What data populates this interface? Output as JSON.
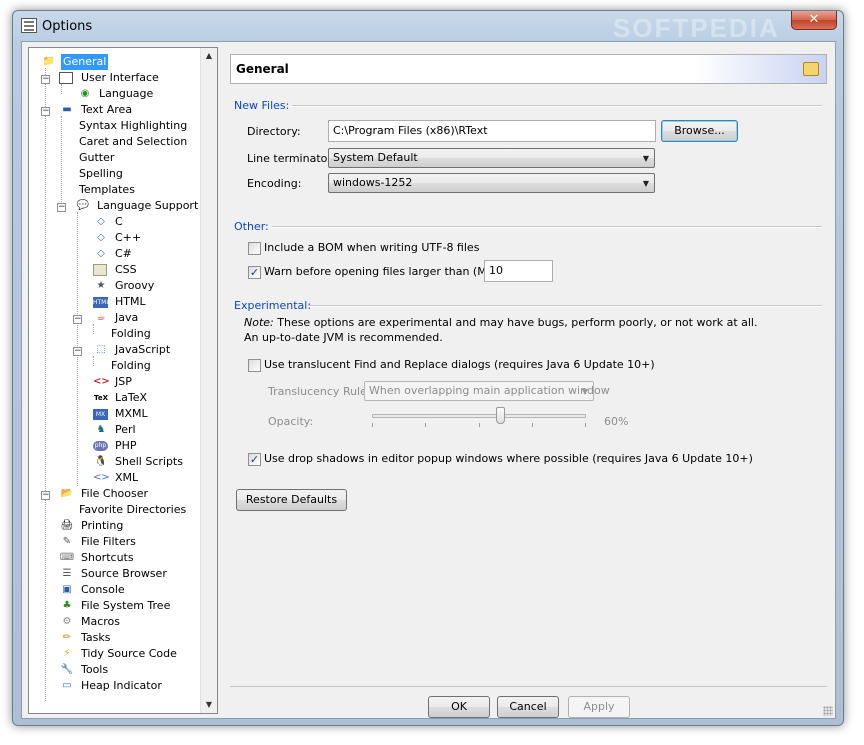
{
  "window": {
    "title": "Options",
    "watermark": "SOFTPEDIA",
    "close_label": "✕"
  },
  "tree": {
    "items": [
      {
        "label": "General",
        "icon": "folder-icon",
        "selected": true
      },
      {
        "label": "User Interface",
        "icon": "window-icon"
      },
      {
        "label": "Language",
        "icon": "globe-icon"
      },
      {
        "label": "Text Area",
        "icon": "text-area-icon"
      },
      {
        "label": "Syntax Highlighting"
      },
      {
        "label": "Caret and Selection"
      },
      {
        "label": "Gutter"
      },
      {
        "label": "Spelling"
      },
      {
        "label": "Templates"
      },
      {
        "label": "Language Support",
        "icon": "speech-bubble-icon"
      },
      {
        "label": "C",
        "icon": "c-file-icon"
      },
      {
        "label": "C++",
        "icon": "cpp-file-icon"
      },
      {
        "label": "C#",
        "icon": "csharp-file-icon"
      },
      {
        "label": "CSS",
        "icon": "css-file-icon"
      },
      {
        "label": "Groovy",
        "icon": "groovy-icon"
      },
      {
        "label": "HTML",
        "icon": "html-icon"
      },
      {
        "label": "Java",
        "icon": "java-cup-icon"
      },
      {
        "label": "Folding"
      },
      {
        "label": "JavaScript",
        "icon": "javascript-icon"
      },
      {
        "label": "Folding"
      },
      {
        "label": "JSP",
        "icon": "jsp-icon"
      },
      {
        "label": "LaTeX",
        "icon": "latex-icon"
      },
      {
        "label": "MXML",
        "icon": "mxml-icon"
      },
      {
        "label": "Perl",
        "icon": "camel-icon"
      },
      {
        "label": "PHP",
        "icon": "php-icon"
      },
      {
        "label": "Shell Scripts",
        "icon": "penguin-icon"
      },
      {
        "label": "XML",
        "icon": "xml-icon"
      },
      {
        "label": "File Chooser",
        "icon": "open-folder-icon"
      },
      {
        "label": "Favorite Directories"
      },
      {
        "label": "Printing",
        "icon": "printer-icon"
      },
      {
        "label": "File Filters",
        "icon": "filter-icon"
      },
      {
        "label": "Shortcuts",
        "icon": "keyboard-icon"
      },
      {
        "label": "Source Browser",
        "icon": "list-icon"
      },
      {
        "label": "Console",
        "icon": "monitor-icon"
      },
      {
        "label": "File System Tree",
        "icon": "tree-icon"
      },
      {
        "label": "Macros",
        "icon": "gear-icon"
      },
      {
        "label": "Tasks",
        "icon": "pencil-icon"
      },
      {
        "label": "Tidy Source Code",
        "icon": "lightning-icon"
      },
      {
        "label": "Tools",
        "icon": "wrench-icon"
      },
      {
        "label": "Heap Indicator",
        "icon": "heap-icon"
      }
    ],
    "expanders": [
      "−",
      "−",
      "−",
      "−",
      "−",
      "−",
      "−"
    ]
  },
  "panel": {
    "title": "General",
    "new_files": {
      "section_label": "New Files:",
      "directory_label": "Directory:",
      "directory_value": "C:\\Program Files (x86)\\RText",
      "browse_label": "Browse...",
      "line_terminator_label": "Line terminator:",
      "line_terminator_value": "System Default",
      "encoding_label": "Encoding:",
      "encoding_value": "windows-1252"
    },
    "other": {
      "section_label": "Other:",
      "bom_label": "Include a BOM when writing UTF-8 files",
      "bom_checked": false,
      "warn_label": "Warn before opening files larger than (MB):",
      "warn_checked": true,
      "warn_value": "10"
    },
    "experimental": {
      "section_label": "Experimental:",
      "note_prefix": "Note:",
      "note_text": " These options are experimental and may have bugs, perform poorly, or not work at all.",
      "note_text_2": "An up-to-date JVM is recommended.",
      "translucent_label": "Use translucent Find and Replace dialogs (requires Java 6 Update 10+)",
      "translucent_checked": false,
      "rule_label": "Translucency Rule:",
      "rule_value": "When overlapping main application window",
      "opacity_label": "Opacity:",
      "opacity_value": 60,
      "opacity_text": "60%",
      "shadows_label": "Use drop shadows in editor popup windows where possible (requires Java 6 Update 10+)",
      "shadows_checked": true
    },
    "restore_label": "Restore Defaults"
  },
  "footer": {
    "ok_label": "OK",
    "cancel_label": "Cancel",
    "apply_label": "Apply"
  },
  "check_glyph": "✓",
  "colors": {
    "selection": "#3399ff",
    "section_label": "#0b46c2",
    "close": "#c0432a"
  }
}
